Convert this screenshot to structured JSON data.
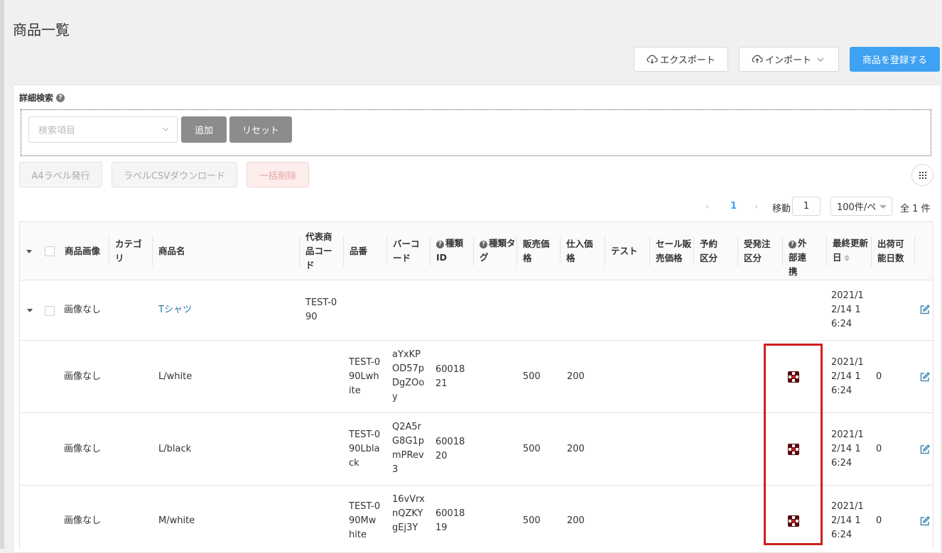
{
  "page": {
    "title": "商品一覧"
  },
  "toolbar": {
    "export_label": "エクスポート",
    "import_label": "インポート",
    "register_label": "商品を登録する"
  },
  "search": {
    "section_label": "詳細検索",
    "field_placeholder": "検索項目",
    "add_label": "追加",
    "reset_label": "リセット"
  },
  "actions": {
    "a4_label": "A4ラベル発行",
    "csv_label": "ラベルCSVダウンロード",
    "bulk_delete_label": "一括削除"
  },
  "pagination": {
    "current_page": "1",
    "move_label": "移動",
    "move_value": "1",
    "page_size": "100件/ペ",
    "total": "全 1 件"
  },
  "table": {
    "headers": {
      "image": "商品画像",
      "category": "カテゴリ",
      "name": "商品名",
      "rep_code": "代表商品コード",
      "sku": "品番",
      "barcode": "バーコード",
      "type_id": "種類ID",
      "type_tag": "種類タグ",
      "sale_price": "販売価格",
      "cost_price": "仕入価格",
      "test": "テスト",
      "sale_sale_price": "セール販売価格",
      "reservation": "予約区分",
      "order_type": "受発注区分",
      "external": "外部連携",
      "updated": "最終更新日",
      "shippable_days": "出荷可能日数"
    },
    "parent": {
      "image": "画像なし",
      "name": "Tシャツ",
      "rep_code": "TEST-090",
      "updated": "2021/12/14 16:24"
    },
    "rows": [
      {
        "image": "画像なし",
        "name": "L/white",
        "sku": "TEST-090Lwhite",
        "barcode": "aYxKPOD57pDgZOoy",
        "type_id": "6001821",
        "sale_price": "500",
        "cost_price": "200",
        "updated": "2021/12/14 16:24",
        "shippable_days": "0"
      },
      {
        "image": "画像なし",
        "name": "L/black",
        "sku": "TEST-090Lblack",
        "barcode": "Q2A5rG8G1pmPRev3",
        "type_id": "6001820",
        "sale_price": "500",
        "cost_price": "200",
        "updated": "2021/12/14 16:24",
        "shippable_days": "0"
      },
      {
        "image": "画像なし",
        "name": "M/white",
        "sku": "TEST-090Mwhite",
        "barcode": "16vVrxnQZKYgEj3Y",
        "type_id": "6001819",
        "sale_price": "500",
        "cost_price": "200",
        "updated": "2021/12/14 16:24",
        "shippable_days": "0"
      }
    ]
  },
  "icons": {
    "export": "cloud-download-icon",
    "import": "cloud-upload-icon",
    "edit": "edit-icon",
    "external": "external-link-status-icon",
    "grid": "grid-menu-icon"
  },
  "colors": {
    "primary": "#3ea1f2",
    "link": "#2a7ab0",
    "highlight": "#d11f1f"
  }
}
